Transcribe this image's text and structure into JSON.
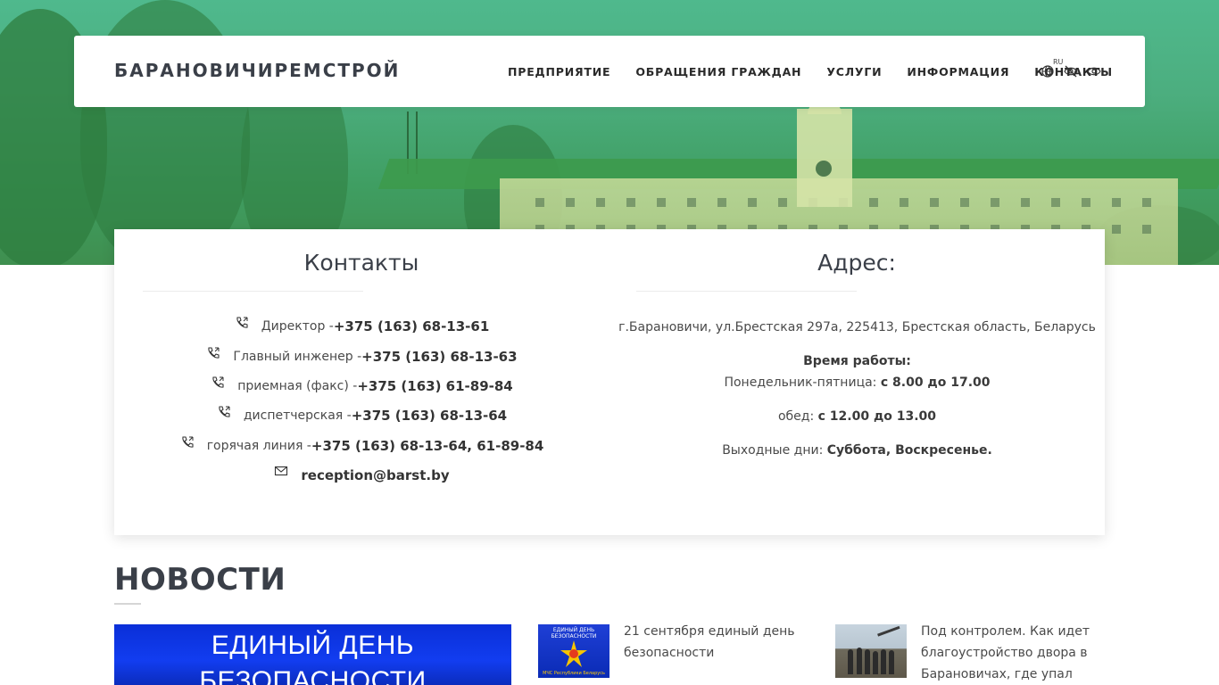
{
  "header": {
    "logo": "БАРАНОВИЧИРЕМСТРОЙ",
    "nav": [
      {
        "label": "ПРЕДПРИЯТИЕ"
      },
      {
        "label": "ОБРАЩЕНИЯ ГРАЖДАН"
      },
      {
        "label": "УСЛУГИ"
      },
      {
        "label": "ИНФОРМАЦИЯ"
      },
      {
        "label": "КОНТАКТЫ"
      }
    ],
    "tools": {
      "language_code": "RU",
      "icons": [
        "globe-icon",
        "eye-slash-icon",
        "eye-icon"
      ]
    }
  },
  "contacts": {
    "title": "Контакты",
    "rows": [
      {
        "label": "Директор - ",
        "value": "+375 (163) 68-13-61",
        "icon": "phone-icon"
      },
      {
        "label": "Главный инженер - ",
        "value": "+375 (163) 68-13-63",
        "icon": "phone-icon"
      },
      {
        "label": "приемная (факс) - ",
        "value": "+375 (163) 61-89-84",
        "icon": "phone-icon"
      },
      {
        "label": "диспетчерская - ",
        "value": "+375 (163) 68-13-64",
        "icon": "phone-icon"
      },
      {
        "label": "горячая линия - ",
        "value": "+375 (163) 68-13-64, 61-89-84",
        "icon": "phone-icon"
      },
      {
        "label": "",
        "value": "reception@barst.by",
        "icon": "mail-icon"
      }
    ]
  },
  "address": {
    "title": "Адрес:",
    "line": "г.Барановичи, ул.Брестская 297а, 225413, Брестская область, Беларусь",
    "hours_title": "Время работы:",
    "weekdays_label": "Понедельник-пятница: ",
    "weekdays_value": "с 8.00 до 17.00",
    "lunch_label": "обед: ",
    "lunch_value": "с 12.00 до 13.00",
    "weekend_label": "Выходные дни: ",
    "weekend_value": "Суббота, Воскресенье."
  },
  "news": {
    "title": "НОВОСТИ",
    "featured_image_text": [
      "ЕДИНЫЙ ДЕНЬ",
      "БЕЗОПАСНОСТИ"
    ],
    "items": [
      {
        "title": "21 сентября единый день безопасности",
        "thumb_text": "ЕДИНЫЙ ДЕНЬ БЕЗОПАСНОСТИ",
        "thumb_caption": "МЧС Республики Беларусь"
      },
      {
        "title": "Под контролем. Как идет благоустройство двора в Барановичах, где упал"
      }
    ]
  },
  "colors": {
    "hero_green": "#4fb98d",
    "text_dark": "#3a3f48",
    "news_blue": "#0a2fd8"
  }
}
